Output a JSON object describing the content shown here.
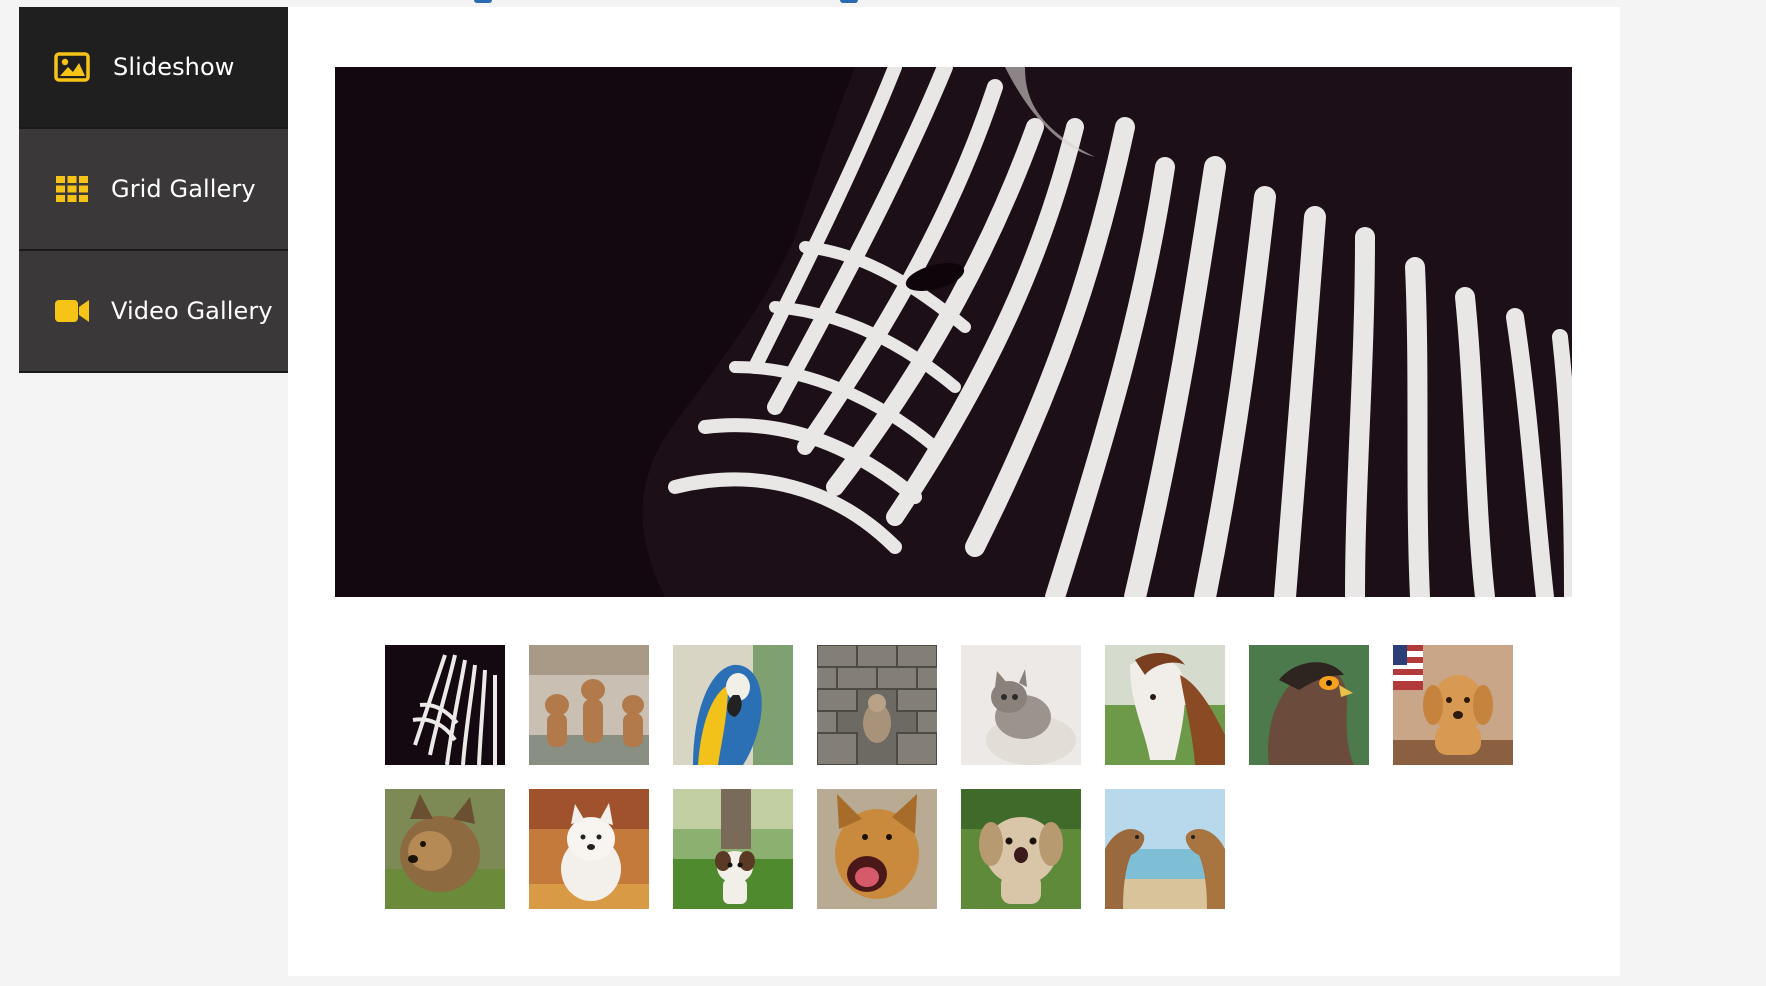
{
  "tabs": [
    {
      "label": "Slideshow",
      "icon": "image-icon",
      "active": true
    },
    {
      "label": "Grid Gallery",
      "icon": "grid-icon",
      "active": false
    },
    {
      "label": "Video Gallery",
      "icon": "video-camera-icon",
      "active": false
    }
  ],
  "colors": {
    "accent": "#f5c416",
    "tab_active_bg": "#1f1f1f",
    "tab_bg": "#3a3838",
    "panel_bg": "#ffffff",
    "page_bg": "#f4f4f4"
  },
  "slideshow": {
    "current_slide": "zebra",
    "thumbnails": [
      "zebra",
      "puppies",
      "parrot",
      "cat-on-wall",
      "kitten",
      "horse",
      "eagle",
      "golden-retriever",
      "yorkshire-terrier",
      "westie",
      "dog-by-tree",
      "yawning-dog",
      "shih-tzu",
      "camels"
    ]
  }
}
